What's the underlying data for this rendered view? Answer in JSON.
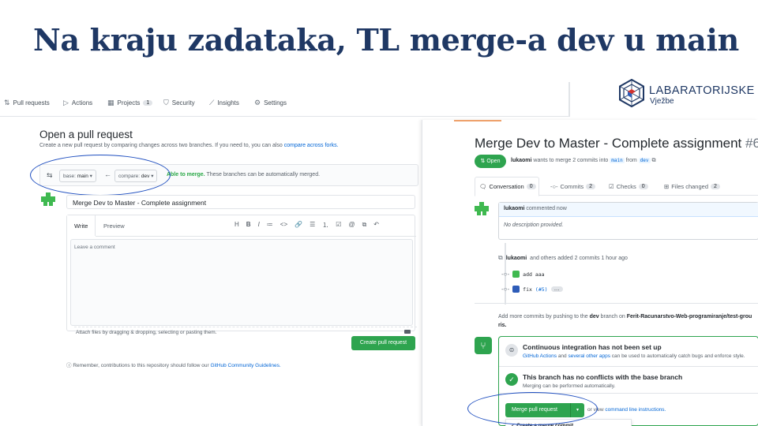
{
  "slide": {
    "title": "Na kraju zadataka, TL merge-a dev u main"
  },
  "logo": {
    "name": "LABARATORIJSKE",
    "sub": "Vježbe"
  },
  "left": {
    "nav": [
      {
        "label": "Pull requests",
        "icon": "pull-request-icon"
      },
      {
        "label": "Actions",
        "icon": "play-icon"
      },
      {
        "label": "Projects",
        "icon": "project-icon",
        "count": "1"
      },
      {
        "label": "Security",
        "icon": "shield-icon"
      },
      {
        "label": "Insights",
        "icon": "graph-icon"
      },
      {
        "label": "Settings",
        "icon": "gear-icon"
      }
    ],
    "heading": "Open a pull request",
    "description": "Create a new pull request by comparing changes across two branches. If you need to, you can also",
    "description_link": "compare across forks.",
    "base_label": "base:",
    "base_value": "main",
    "compare_label": "compare:",
    "compare_value": "dev",
    "able_to_merge": "Able to merge.",
    "merge_note": "These branches can be automatically merged.",
    "title_value": "Merge Dev to Master - Complete assignment",
    "tab_write": "Write",
    "tab_preview": "Preview",
    "toolbar": [
      "H",
      "B",
      "I",
      "≔",
      "<>",
      "🔗",
      "☰",
      "⒈",
      "☑",
      "@",
      "⧉",
      "↶"
    ],
    "comment_placeholder": "Leave a comment",
    "attach_text": "Attach files by dragging & dropping, selecting or pasting them.",
    "create_button": "Create pull request",
    "remember_text": "Remember, contributions to this repository should follow our",
    "remember_link": "GitHub Community Guidelines."
  },
  "right": {
    "title": "Merge Dev to Master - Complete assignment",
    "number": "#6",
    "status": "Open",
    "meta_user": "lukaomi",
    "meta_text": "wants to merge 2 commits into",
    "meta_base": "main",
    "meta_from": "from",
    "meta_head": "dev",
    "tabs": [
      {
        "label": "Conversation",
        "count": "0"
      },
      {
        "label": "Commits",
        "count": "2"
      },
      {
        "label": "Checks",
        "count": "0"
      },
      {
        "label": "Files changed",
        "count": "2"
      }
    ],
    "comment_user": "lukaomi",
    "comment_when": "commented now",
    "comment_body": "No description provided.",
    "event_user": "lukaomi",
    "event_text": "and others added 2 commits 1 hour ago",
    "commit1": "add aaa",
    "commit2_msg": "fix",
    "commit2_ref": "(#5)",
    "push_text_1": "Add more commits by pushing to the",
    "push_branch": "dev",
    "push_text_2": "branch on",
    "push_repo": "Ferit-Racunarstvo-Web-programiranje/test-grou",
    "push_repo_tail": "ris.",
    "ci_title": "Continuous integration has not been set up",
    "ci_link1": "GitHub Actions",
    "ci_and": "and",
    "ci_link2": "several other apps",
    "ci_tail": "can be used to automatically catch bugs and enforce style.",
    "nc_title": "This branch has no conflicts with the base branch",
    "nc_sub": "Merging can be performed automatically.",
    "merge_button": "Merge pull request",
    "or_view": "or view",
    "cli_link": "command line instructions.",
    "dropdown_item": "✓ Create a merge commit"
  },
  "colors": {
    "title": "#1f3864",
    "green": "#2ea44f",
    "link": "#0366d6",
    "annotation": "#1f4fc0"
  }
}
